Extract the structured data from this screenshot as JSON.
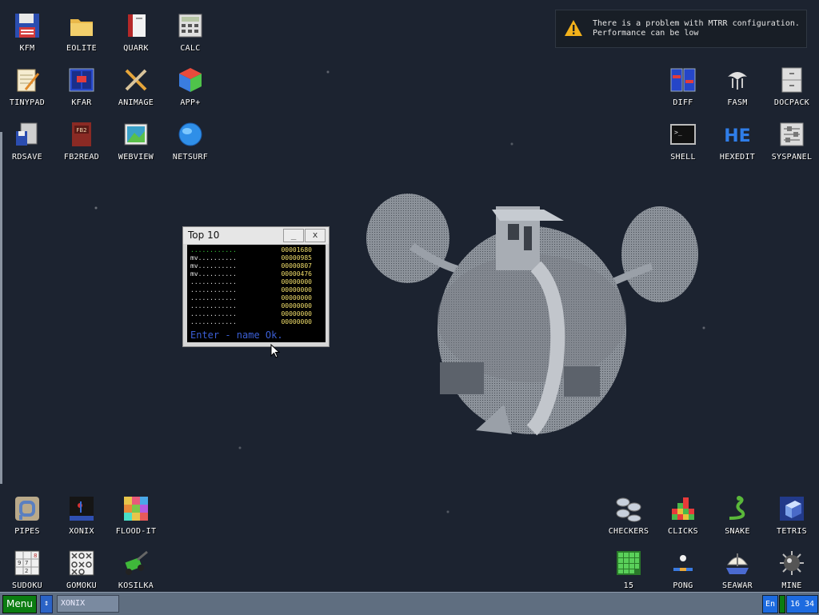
{
  "desktop": {
    "icons": [
      {
        "label": "KFM",
        "glyph": "floppy-disk-icon"
      },
      {
        "label": "EOLITE",
        "glyph": "folder-icon"
      },
      {
        "label": "QUARK",
        "glyph": "book-icon"
      },
      {
        "label": "CALC",
        "glyph": "calculator-icon"
      },
      {
        "label": "TINYPAD",
        "glyph": "notepad-icon"
      },
      {
        "label": "KFAR",
        "glyph": "file-manager-icon"
      },
      {
        "label": "ANIMAGE",
        "glyph": "paint-tools-icon"
      },
      {
        "label": "APP+",
        "glyph": "rubik-cube-icon"
      },
      {
        "label": "RDSAVE",
        "glyph": "ramdisk-save-icon"
      },
      {
        "label": "FB2READ",
        "glyph": "fb2-book-icon"
      },
      {
        "label": "WEBVIEW",
        "glyph": "web-picture-icon"
      },
      {
        "label": "NETSURF",
        "glyph": "globe-icon"
      },
      {
        "label": "DIFF",
        "glyph": "diff-icon"
      },
      {
        "label": "FASM",
        "glyph": "fasm-icon"
      },
      {
        "label": "DOCPACK",
        "glyph": "cabinet-icon"
      },
      {
        "label": "SHELL",
        "glyph": "terminal-icon"
      },
      {
        "label": "HEXEDIT",
        "glyph": "hexedit-icon"
      },
      {
        "label": "SYSPANEL",
        "glyph": "sliders-icon"
      },
      {
        "label": "PIPES",
        "glyph": "pipes-icon"
      },
      {
        "label": "XONIX",
        "glyph": "xonix-icon"
      },
      {
        "label": "FLOOD-IT",
        "glyph": "color-grid-icon"
      },
      {
        "label": "SUDOKU",
        "glyph": "sudoku-icon"
      },
      {
        "label": "GOMOKU",
        "glyph": "gomoku-icon"
      },
      {
        "label": "KOSILKA",
        "glyph": "lawnmower-icon"
      },
      {
        "label": "CHECKERS",
        "glyph": "checkers-icon"
      },
      {
        "label": "CLICKS",
        "glyph": "blocks-icon"
      },
      {
        "label": "SNAKE",
        "glyph": "snake-icon"
      },
      {
        "label": "TETRIS",
        "glyph": "tetris-icon"
      },
      {
        "label": "15",
        "glyph": "fifteen-puzzle-icon"
      },
      {
        "label": "PONG",
        "glyph": "pong-icon"
      },
      {
        "label": "SEAWAR",
        "glyph": "seawar-icon"
      },
      {
        "label": "MINE",
        "glyph": "mine-icon"
      }
    ]
  },
  "notification": {
    "line1": "There is a problem with MTRR configuration.",
    "line2": "Performance can be low",
    "icon": "warning-icon"
  },
  "top10_window": {
    "title": "Top 10",
    "minimize_label": "_",
    "close_label": "x",
    "scores": [
      {
        "name": "............",
        "score": "00001680"
      },
      {
        "name": "mv..........",
        "score": "00000985"
      },
      {
        "name": "mv..........",
        "score": "00000807"
      },
      {
        "name": "mv..........",
        "score": "00000476"
      },
      {
        "name": "............",
        "score": "00000000"
      },
      {
        "name": "............",
        "score": "00000000"
      },
      {
        "name": "............",
        "score": "00000000"
      },
      {
        "name": "............",
        "score": "00000000"
      },
      {
        "name": "............",
        "score": "00000000"
      },
      {
        "name": "............",
        "score": "00000000"
      }
    ],
    "prompt": "Enter - name Ok."
  },
  "taskbar": {
    "menu_label": "Menu",
    "switch_label": "↕",
    "tasks": [
      "XONIX"
    ],
    "language": "En",
    "clock": "16 34"
  },
  "colors": {
    "desktop_bg": "#1c2330",
    "taskbar_bg": "#5f6e80",
    "menu_green": "#0b7d11",
    "tray_blue": "#1d6be0",
    "score_yellow": "#f2df6b",
    "name_green": "#39d13a"
  }
}
